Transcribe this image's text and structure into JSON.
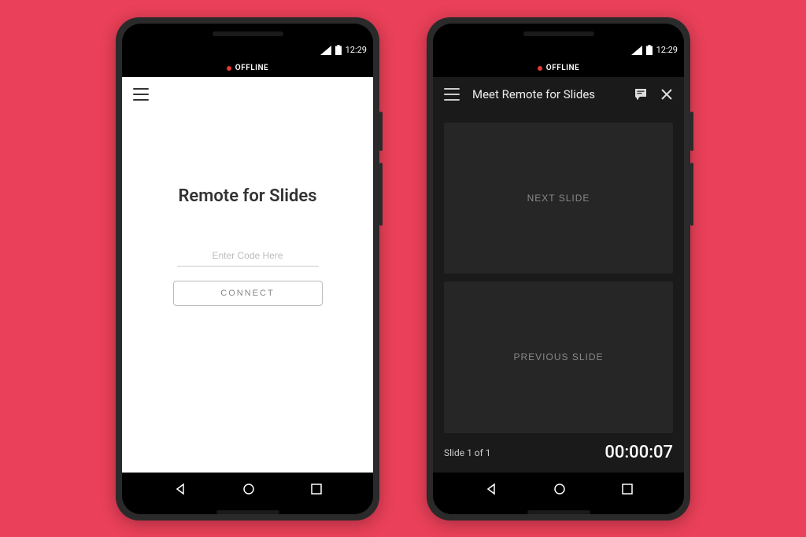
{
  "statusBar": {
    "time": "12:29"
  },
  "offlineBar": {
    "label": "OFFLINE"
  },
  "screen1": {
    "title": "Remote for Slides",
    "codePlaceholder": "Enter Code Here",
    "connectLabel": "CONNECT"
  },
  "screen2": {
    "headerTitle": "Meet Remote for Slides",
    "nextSlideLabel": "NEXT SLIDE",
    "prevSlideLabel": "PREVIOUS SLIDE",
    "slideCounter": "Slide 1 of 1",
    "timer": "00:00:07"
  }
}
